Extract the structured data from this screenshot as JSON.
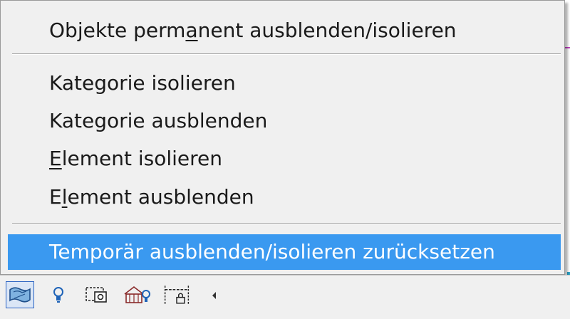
{
  "context_menu": {
    "items": [
      {
        "label": "Objekte perm",
        "mnemonic": "a",
        "label_rest": "nent ausblenden/isolieren"
      },
      {
        "label": "Kategorie isolieren"
      },
      {
        "label": "Kategorie ausblenden"
      },
      {
        "mnemonic": "E",
        "label_rest": "lement isolieren"
      },
      {
        "label": "E",
        "mnemonic": "l",
        "label_rest": "ement ausblenden"
      },
      {
        "label": "Temporär ausblenden/isolieren zurücksetzen"
      }
    ]
  },
  "view_control_bar": {
    "icons": [
      "temporary-hide-isolate-icon",
      "reveal-hidden-elements-icon",
      "temporary-view-properties-icon",
      "show-analytical-model-icon",
      "highlight-displacement-set-icon",
      "scroll-left-icon"
    ]
  },
  "colors": {
    "menu_background": "#f0f0f0",
    "highlight": "#3a99f0",
    "highlight_text": "#ffffff",
    "text": "#1a1a1a",
    "active_button_border": "#2b63c2"
  }
}
